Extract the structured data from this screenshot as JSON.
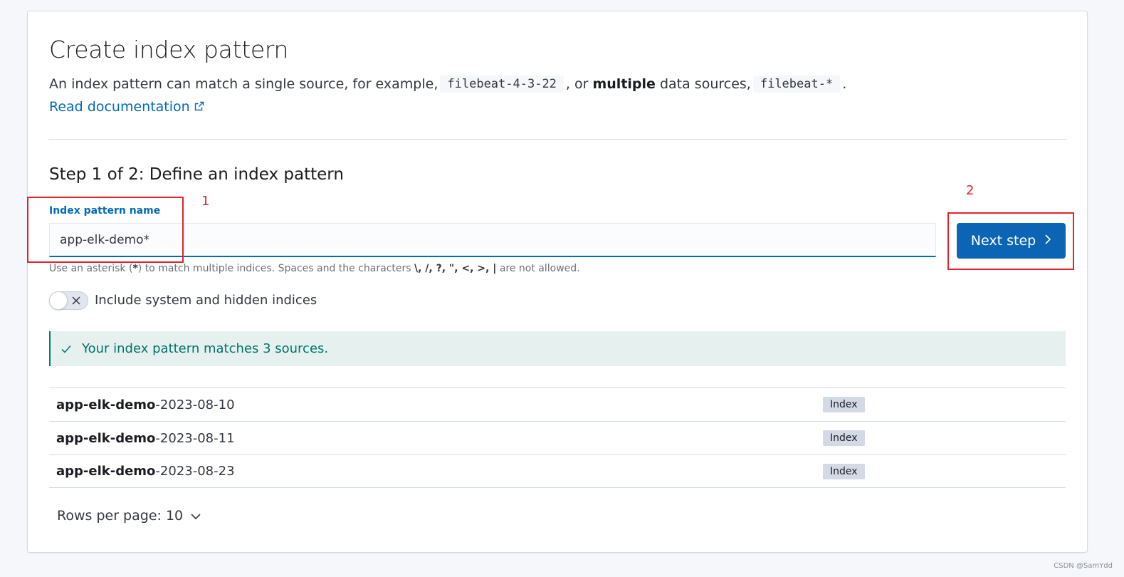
{
  "header": {
    "title": "Create index pattern",
    "description_pre": "An index pattern can match a single source, for example,",
    "example_single": "filebeat-4-3-22",
    "description_mid_pre": ", or",
    "description_bold": "multiple",
    "description_mid_post": "data sources,",
    "example_multi": "filebeat-*",
    "description_end": ".",
    "doc_link": "Read documentation"
  },
  "step": {
    "title": "Step 1 of 2: Define an index pattern",
    "field_label": "Index pattern name",
    "field_value": "app-elk-demo*",
    "help_pre": "Use an asterisk (",
    "help_asterisk": "*",
    "help_mid": ") to match multiple indices. Spaces and the characters",
    "help_chars": "\\, /, ?, \", <, >, |",
    "help_end": "are not allowed.",
    "next_button": "Next step",
    "toggle_label": "Include system and hidden indices",
    "toggle_on": false
  },
  "callout": {
    "text": "Your index pattern matches 3 sources."
  },
  "indices": [
    {
      "match": "app-elk-demo",
      "rest": "-2023-08-10",
      "type": "Index"
    },
    {
      "match": "app-elk-demo",
      "rest": "-2023-08-11",
      "type": "Index"
    },
    {
      "match": "app-elk-demo",
      "rest": "-2023-08-23",
      "type": "Index"
    }
  ],
  "pagination": {
    "rows_per_page": "Rows per page: 10"
  },
  "annotations": {
    "box1": "1",
    "box2": "2"
  },
  "watermark": "CSDN @SamYdd",
  "colors": {
    "primary": "#0b64b4",
    "link": "#006bb8",
    "success": "#017d73",
    "annotation_red": "#e8212b"
  }
}
